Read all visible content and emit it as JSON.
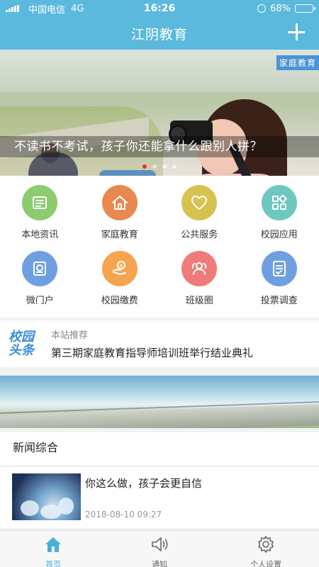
{
  "status_bar": {
    "carrier": "中国电信",
    "network": "4G",
    "time": "16:26",
    "battery_percent": "68%",
    "battery_level": 0.68
  },
  "nav": {
    "title": "江阴教育",
    "add_icon": "plus-icon"
  },
  "banner": {
    "tag": "家庭教育",
    "caption": "不读书不考试，孩子你还能拿什么跟别人拼？",
    "slide_count": 4,
    "active_slide": 1
  },
  "menu": {
    "items": [
      {
        "label": "本地资讯",
        "icon": "newspaper-icon",
        "color": "#8ccc6e"
      },
      {
        "label": "家庭教育",
        "icon": "house-icon",
        "color": "#e8894f"
      },
      {
        "label": "公共服务",
        "icon": "heart-icon",
        "color": "#d7c24f"
      },
      {
        "label": "校园应用",
        "icon": "apps-icon",
        "color": "#6fc7c2"
      },
      {
        "label": "微门户",
        "icon": "portal-icon",
        "color": "#6f9fe0"
      },
      {
        "label": "校园缴费",
        "icon": "payment-icon",
        "color": "#f5a54f"
      },
      {
        "label": "班级圈",
        "icon": "class-circle-icon",
        "color": "#ef7b7b"
      },
      {
        "label": "投票调查",
        "icon": "vote-icon",
        "color": "#6f9fe0"
      }
    ]
  },
  "headline": {
    "logo_line1": "校园",
    "logo_line2": "头条",
    "subtitle": "本站推荐",
    "title": "第三期家庭教育指导师培训班举行结业典礼"
  },
  "news": {
    "section_title": "新闻综合",
    "items": [
      {
        "title": "你这么做，孩子会更自信",
        "date": "2018-08-10 09:27"
      }
    ]
  },
  "tabbar": {
    "tabs": [
      {
        "label": "首页",
        "icon": "home-icon",
        "active": true
      },
      {
        "label": "通知",
        "icon": "speaker-icon",
        "active": false
      },
      {
        "label": "个人设置",
        "icon": "settings-icon",
        "active": false
      }
    ],
    "active_color": "#4aafd9",
    "inactive_color": "#666666"
  }
}
